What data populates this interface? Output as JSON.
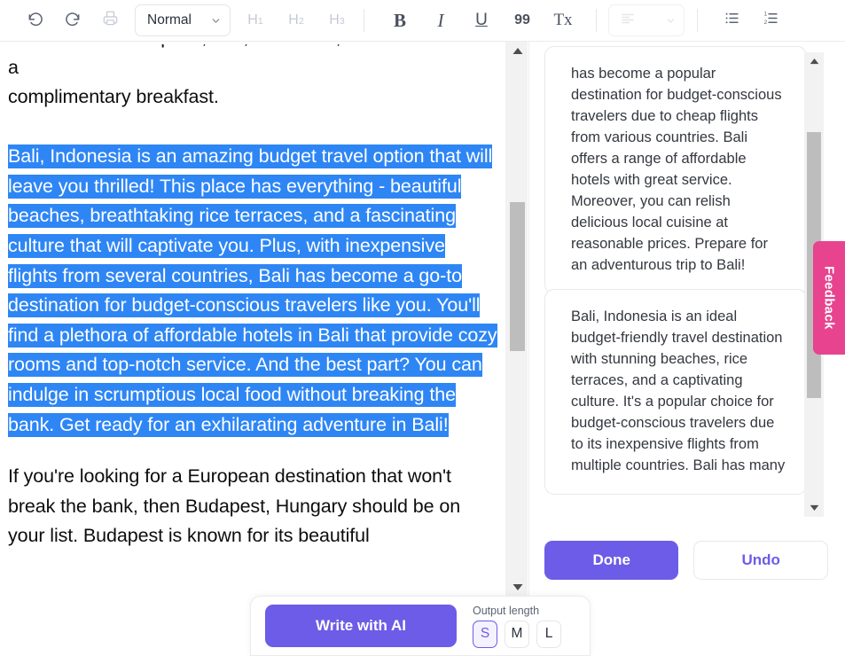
{
  "toolbar": {
    "undo_icon": "undo-icon",
    "redo_icon": "redo-icon",
    "print_icon": "print-icon",
    "style_select": {
      "value": "Normal",
      "caret_icon": "chevron-down-icon"
    },
    "headings": [
      {
        "label": "H",
        "sub": "1",
        "name": "heading-1"
      },
      {
        "label": "H",
        "sub": "2",
        "name": "heading-2"
      },
      {
        "label": "H",
        "sub": "3",
        "name": "heading-3"
      }
    ],
    "format": {
      "bold": "B",
      "italic": "I",
      "underline": "U",
      "quote": "99",
      "clear_format": "Tx"
    },
    "align_icon": "align-left-icon",
    "align_caret_icon": "chevron-down-icon",
    "bullet_list_icon": "bulleted-list-icon",
    "numbered_list_icon": "numbered-list-icon"
  },
  "document": {
    "clipped_line": "for an affordable option, Bali, Indonesia, with free wifi and a",
    "paragraph_1": "complimentary breakfast.",
    "selected_paragraph": "Bali, Indonesia is an amazing budget travel option that will leave you thrilled! This place has everything - beautiful beaches, breathtaking rice terraces, and a fascinating culture that will captivate you. Plus, with inexpensive flights from several countries, Bali has become a go-to destination for budget-conscious travelers like you. You'll find a plethora of affordable hotels in Bali that provide cozy rooms and top-notch service. And the best part? You can indulge in scrumptious local food without breaking the bank. Get ready for an exhilarating adventure in Bali!",
    "paragraph_3": "If you're looking for a European destination that won't break the bank, then Budapest, Hungary should be on your list. Budapest is known for its beautiful",
    "selection_color": "#2e86f5"
  },
  "scrollbars": {
    "document": {
      "up_icon": "scroll-up-arrow-icon",
      "down_icon": "scroll-down-arrow-icon"
    },
    "panel": {
      "up_icon": "scroll-up-arrow-icon",
      "down_icon": "scroll-down-arrow-icon"
    }
  },
  "panel": {
    "suggestion_1": "has become a popular destination for budget-conscious travelers due to cheap flights from various countries. Bali offers a range of affordable hotels with great service. Moreover, you can relish delicious local cuisine at reasonable prices. Prepare for an adventurous trip to Bali!",
    "suggestion_2": "Bali, Indonesia is an ideal budget-friendly travel destination with stunning beaches, rice terraces, and a captivating culture. It's a popular choice for budget-conscious travelers due to its inexpensive flights from multiple countries. Bali has many",
    "done_label": "Done",
    "undo_label": "Undo",
    "accent_color": "#6c5ce7"
  },
  "feedback": {
    "label": "Feedback",
    "color": "#e8438f"
  },
  "ai_bar": {
    "write_label": "Write with AI",
    "output_length_label": "Output length",
    "sizes": [
      {
        "label": "S",
        "selected": true
      },
      {
        "label": "M",
        "selected": false
      },
      {
        "label": "L",
        "selected": false
      }
    ]
  }
}
